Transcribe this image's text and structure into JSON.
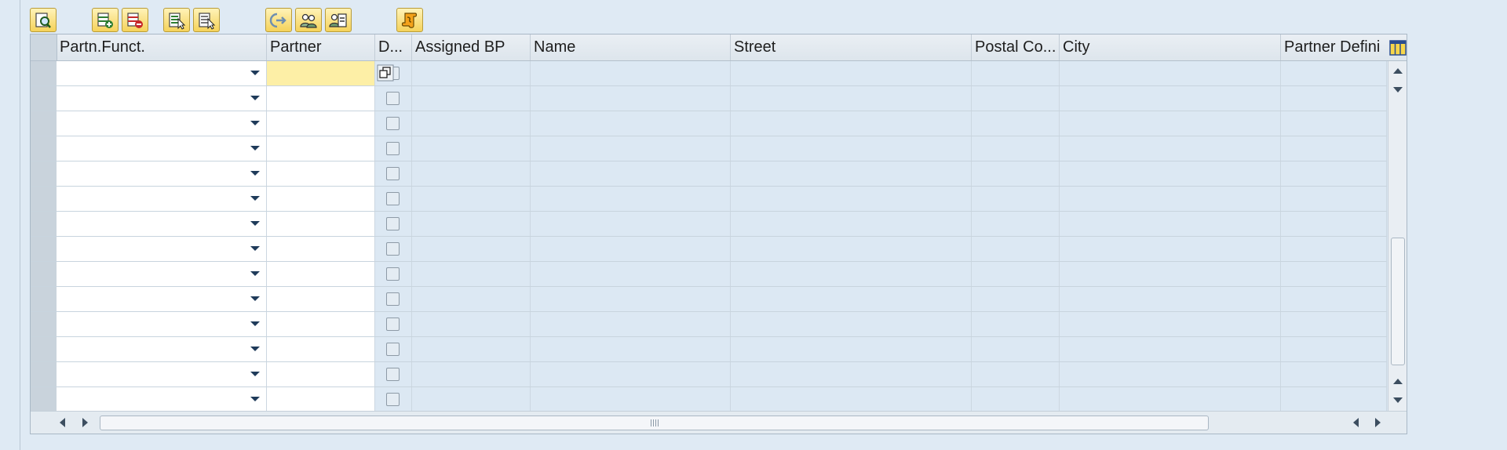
{
  "toolbar": {
    "buttons": [
      {
        "icon": "details-icon",
        "label": "Details"
      },
      {
        "icon": "insert-row-icon",
        "label": "Insert Row"
      },
      {
        "icon": "delete-row-icon",
        "label": "Delete Row"
      },
      {
        "icon": "select-all-icon",
        "label": "Select All"
      },
      {
        "icon": "deselect-all-icon",
        "label": "Deselect All"
      },
      {
        "icon": "navigate-icon",
        "label": "Navigate"
      },
      {
        "icon": "partner-icon",
        "label": "Partner"
      },
      {
        "icon": "partner-details-icon",
        "label": "Partner Details"
      },
      {
        "icon": "script-icon",
        "label": "Script"
      }
    ]
  },
  "grid": {
    "columns": [
      {
        "key": "func",
        "label": "Partn.Funct."
      },
      {
        "key": "partner",
        "label": "Partner"
      },
      {
        "key": "d",
        "label": "D..."
      },
      {
        "key": "assigned",
        "label": "Assigned BP"
      },
      {
        "key": "name",
        "label": "Name"
      },
      {
        "key": "street",
        "label": "Street"
      },
      {
        "key": "postal",
        "label": "Postal Co..."
      },
      {
        "key": "city",
        "label": "City"
      },
      {
        "key": "definition",
        "label": "Partner Defini"
      }
    ],
    "row_count": 14,
    "focused_row": 0,
    "rows": [
      {
        "func": "",
        "partner": "",
        "d": false
      },
      {
        "func": "",
        "partner": "",
        "d": false
      },
      {
        "func": "",
        "partner": "",
        "d": false
      },
      {
        "func": "",
        "partner": "",
        "d": false
      },
      {
        "func": "",
        "partner": "",
        "d": false
      },
      {
        "func": "",
        "partner": "",
        "d": false
      },
      {
        "func": "",
        "partner": "",
        "d": false
      },
      {
        "func": "",
        "partner": "",
        "d": false
      },
      {
        "func": "",
        "partner": "",
        "d": false
      },
      {
        "func": "",
        "partner": "",
        "d": false
      },
      {
        "func": "",
        "partner": "",
        "d": false
      },
      {
        "func": "",
        "partner": "",
        "d": false
      },
      {
        "func": "",
        "partner": "",
        "d": false
      },
      {
        "func": "",
        "partner": "",
        "d": false
      }
    ]
  },
  "colors": {
    "background": "#dfeaf4",
    "focus_cell": "#fdefa6",
    "toolbar_button": "#f5d25a"
  }
}
